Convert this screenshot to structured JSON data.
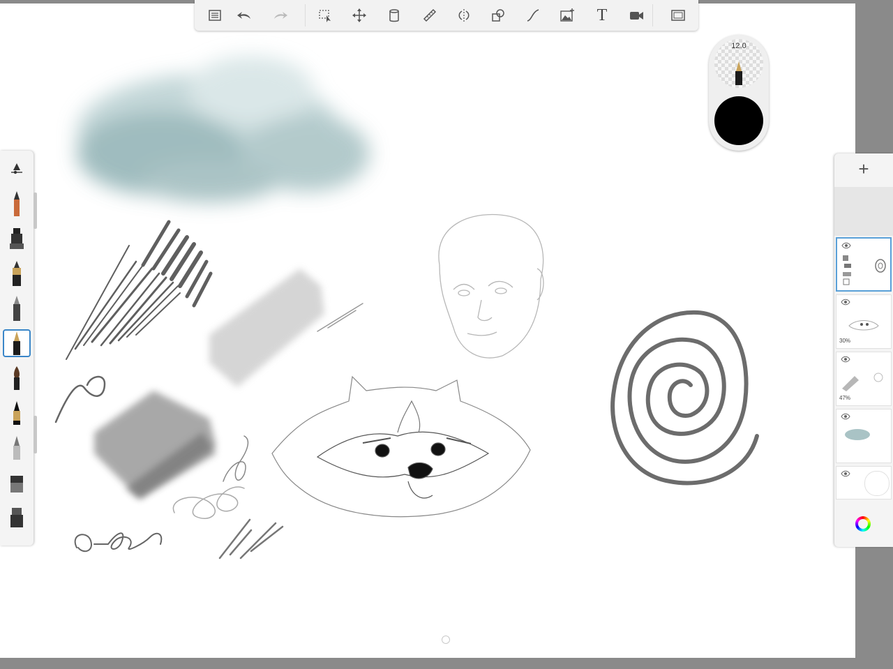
{
  "toolbar": {
    "buttons": [
      {
        "name": "list-icon"
      },
      {
        "name": "undo-icon"
      },
      {
        "name": "redo-icon"
      },
      {
        "name": "selection-icon"
      },
      {
        "name": "transform-icon"
      },
      {
        "name": "fill-icon"
      },
      {
        "name": "ruler-icon"
      },
      {
        "name": "symmetry-icon"
      },
      {
        "name": "shapes-icon"
      },
      {
        "name": "curve-icon"
      },
      {
        "name": "image-insert-icon"
      },
      {
        "name": "text-icon",
        "glyph": "T"
      },
      {
        "name": "video-icon"
      },
      {
        "name": "fullscreen-icon"
      }
    ]
  },
  "puck": {
    "brush_size": "12.0",
    "color": "#000000"
  },
  "brush_palette": {
    "items": [
      "brush-settings",
      "pencil",
      "marker",
      "ink-pen",
      "ballpoint",
      "fountain-pen",
      "paint-brush",
      "brush-pen",
      "airbrush",
      "eraser-a",
      "eraser-b"
    ],
    "selected": "fountain-pen"
  },
  "layers_panel": {
    "add_label": "+",
    "layers": [
      {
        "name": "layer-1",
        "active": true,
        "opacity": ""
      },
      {
        "name": "layer-2",
        "active": false,
        "opacity": "30%"
      },
      {
        "name": "layer-3",
        "active": false,
        "opacity": "47%"
      },
      {
        "name": "layer-4",
        "active": false,
        "opacity": ""
      },
      {
        "name": "background-layer",
        "active": false,
        "opacity": ""
      }
    ]
  },
  "colors": {
    "accent": "#3a86c8",
    "canvas": "#ffffff",
    "chrome": "#8a8a8a"
  }
}
